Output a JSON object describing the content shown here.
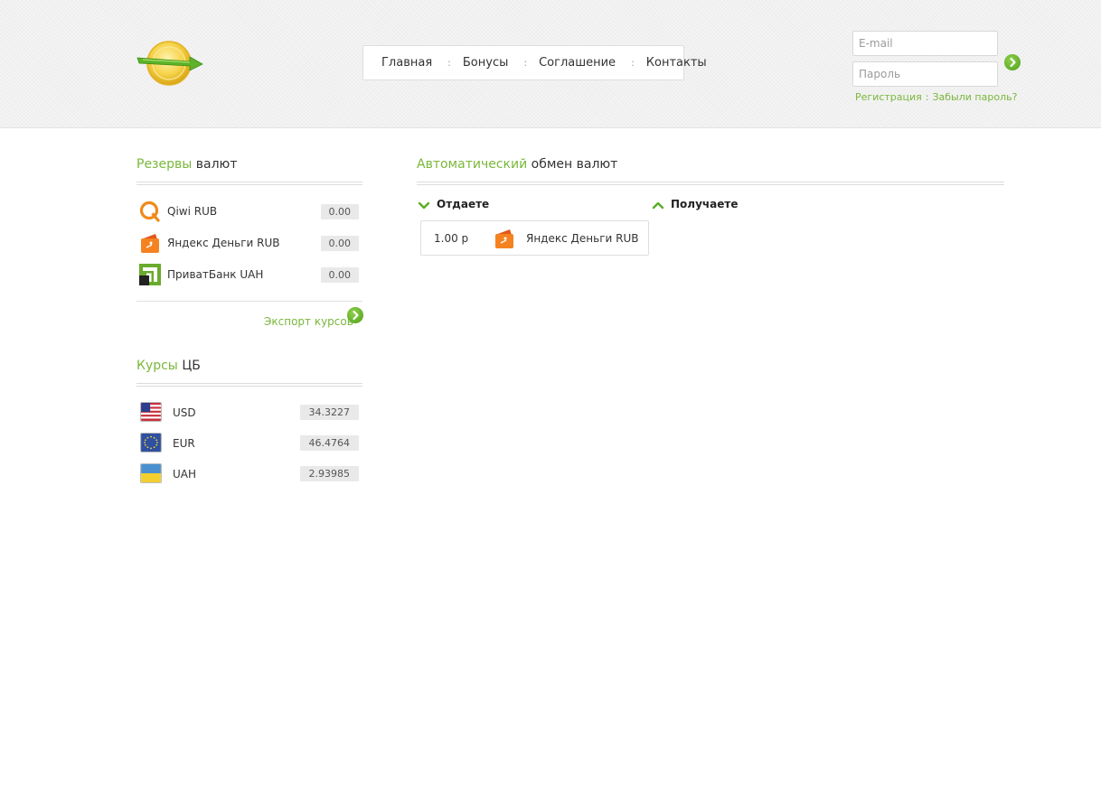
{
  "header": {
    "logo_icon": "coin-arrow-logo-icon",
    "nav": [
      {
        "label": "Главная"
      },
      {
        "label": "Бонусы"
      },
      {
        "label": "Соглашение"
      },
      {
        "label": "Контакты"
      }
    ],
    "nav_separator": ":",
    "login": {
      "email_placeholder": "E-mail",
      "password_placeholder": "Пароль",
      "register_label": "Регистрация",
      "links_separator": ":",
      "forgot_label": "Забыли пароль?"
    }
  },
  "reserves": {
    "title_accent": "Резервы",
    "title_rest": "валют",
    "items": [
      {
        "name": "Qiwi RUB",
        "value": "0.00",
        "icon": "qiwi-icon"
      },
      {
        "name": "Яндекс Деньги RUB",
        "value": "0.00",
        "icon": "yandex-money-icon"
      },
      {
        "name": "ПриватБанк UAH",
        "value": "0.00",
        "icon": "privatbank-icon"
      }
    ],
    "export_label": "Экспорт курсов"
  },
  "rates": {
    "title_accent": "Курсы",
    "title_rest": "ЦБ",
    "items": [
      {
        "code": "USD",
        "value": "34.3227",
        "icon": "usa-flag-icon"
      },
      {
        "code": "EUR",
        "value": "46.4764",
        "icon": "eu-flag-icon"
      },
      {
        "code": "UAH",
        "value": "2.93985",
        "icon": "ukraine-flag-icon"
      }
    ]
  },
  "exchange": {
    "title_accent": "Автоматический",
    "title_rest": "обмен валют",
    "give_label": "Отдаете",
    "receive_label": "Получаете",
    "give_item": {
      "amount": "1.00 р",
      "currency": "Яндекс Деньги RUB",
      "icon": "yandex-money-icon"
    }
  },
  "colors": {
    "accent": "#7ab73b",
    "button": "#5aae24",
    "value_bg": "#e9e9e9",
    "header_bg": "#f1f1f1"
  }
}
